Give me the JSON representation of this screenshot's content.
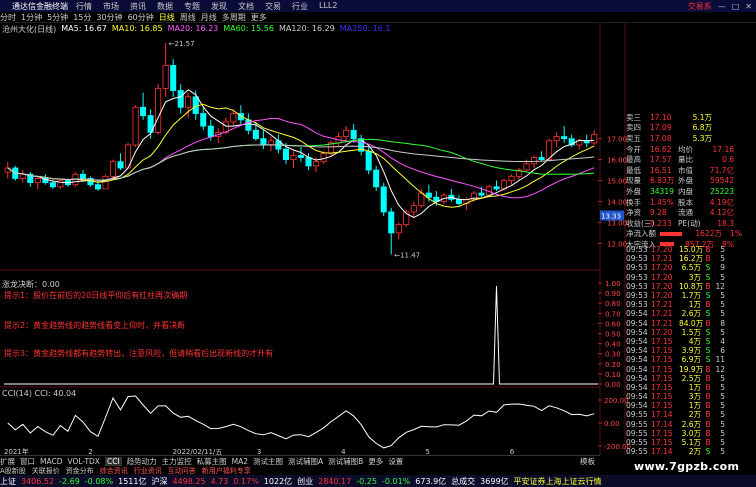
{
  "window": {
    "title": "通达信金融终端",
    "menus": [
      "行情",
      "市场",
      "资讯",
      "数据",
      "专题",
      "发现",
      "文档",
      "交易",
      "行业",
      "LLL2"
    ],
    "account": "交易系"
  },
  "period": {
    "items": [
      "分时",
      "1分钟",
      "5分钟",
      "15分",
      "30分钟",
      "60分钟",
      "日线",
      "周线",
      "月线",
      "多周期",
      "更多"
    ],
    "active": "日线"
  },
  "stock": {
    "name": "沧州大化(日线)"
  },
  "ma": [
    {
      "label": "MA5: 16.67",
      "color": "#ffffff"
    },
    {
      "label": "MA10: 16.85",
      "color": "#ffff33"
    },
    {
      "label": "MA20: 16.23",
      "color": "#ff55ff"
    },
    {
      "label": "MA60: 15.56",
      "color": "#33ff33"
    },
    {
      "label": "MA120: 16.29",
      "color": "#cccccc"
    },
    {
      "label": "MA250: 16.1",
      "color": "#3333ff"
    }
  ],
  "price_axis": [
    "17.00",
    "16.00",
    "15.00",
    "14.00",
    "13.00",
    "12.00"
  ],
  "annot": {
    "high": "21.57",
    "low": "11.47",
    "cur": "13.33"
  },
  "ind1": {
    "header": "涨龙决断：0.00",
    "axis": [
      "1.00",
      "0.90",
      "0.80",
      "0.70",
      "0.60",
      "0.50",
      "0.40",
      "0.30",
      "0.20",
      "0.10",
      "0.00"
    ],
    "tips": [
      "提示1：股价在前后的20日线平仰后有红柱再次确期",
      "提示2：黄金趋势线的趋势线看变上仰时，并看决断",
      "提示3：黄金趋势线都有趋势转出，注意风险，但请稍看后出现新线的才升有"
    ]
  },
  "ind2": {
    "header": "CCI(14) CCI: 40.04",
    "axis": [
      "200.00",
      "0.00",
      "-200.00"
    ]
  },
  "dates": [
    "2021年",
    "2",
    "2022/02/11/五",
    "3",
    "4",
    "5",
    "6"
  ],
  "quote": {
    "top": [
      [
        "卖三",
        "17.10",
        "5.1万"
      ],
      [
        "卖四",
        "17.09",
        "6.8万"
      ],
      [
        "卖五",
        "17.08",
        "5.3万"
      ]
    ],
    "rows": [
      [
        "今开",
        "16.62",
        "均价",
        "17.16"
      ],
      [
        "最高",
        "17.57",
        "量比",
        "0.6"
      ],
      [
        "最低",
        "16.51",
        "市值",
        "71.7亿"
      ],
      [
        "现量",
        "6.83万",
        "外盘",
        "59542"
      ],
      [
        "外盘",
        "34319",
        "内盘",
        "25223"
      ],
      [
        "换手",
        "1.45%",
        "股本",
        "4.19亿"
      ],
      [
        "净资",
        "9.28",
        "流通",
        "4.12亿"
      ],
      [
        "收益(三)",
        "0.233",
        "PE(动)",
        "18.3"
      ]
    ],
    "flow": [
      [
        "净流入额",
        "1622万",
        "1%"
      ],
      [
        "大宗流入",
        "857.2万",
        "8%"
      ]
    ]
  },
  "ticks": [
    [
      "09:53",
      "17.20",
      "15.0万",
      "B",
      "5"
    ],
    [
      "09:53",
      "17.21",
      "16.2万",
      "B",
      "5"
    ],
    [
      "09:53",
      "17.20",
      "6.5万",
      "S",
      "9"
    ],
    [
      "09:53",
      "17.20",
      "3万",
      "S",
      "5"
    ],
    [
      "09:53",
      "17.20",
      "10.8万",
      "B",
      "12"
    ],
    [
      "09:53",
      "17.20",
      "1.7万",
      "S",
      "5"
    ],
    [
      "09:53",
      "17.21",
      "1万",
      "B",
      "5"
    ],
    [
      "09:54",
      "17.21",
      "2.6万",
      "S",
      "5"
    ],
    [
      "09:54",
      "17.21",
      "84.0万",
      "B",
      "8"
    ],
    [
      "09:54",
      "17.20",
      "1.5万",
      "S",
      "5"
    ],
    [
      "09:54",
      "17.15",
      "4万",
      "S",
      "4"
    ],
    [
      "09:54",
      "17.15",
      "3.9万",
      "S",
      "6"
    ],
    [
      "09:54",
      "17.15",
      "6.9万",
      "S",
      "11"
    ],
    [
      "09:54",
      "17.15",
      "19.9万",
      "B",
      "12"
    ],
    [
      "09:54",
      "17.15",
      "2.5万",
      "B",
      "5"
    ],
    [
      "09:54",
      "17.15",
      "1万",
      "B",
      "5"
    ],
    [
      "09:54",
      "17.15",
      "3万",
      "B",
      "5"
    ],
    [
      "09:54",
      "17.15",
      "1万",
      "B",
      "5"
    ],
    [
      "09:55",
      "17.14",
      "2万",
      "B",
      "5"
    ],
    [
      "09:55",
      "17.14",
      "2.6万",
      "B",
      "5"
    ],
    [
      "09:55",
      "17.15",
      "3.0万",
      "B",
      "5"
    ],
    [
      "09:55",
      "17.15",
      "5.1万",
      "B",
      "5"
    ],
    [
      "09:55",
      "17.14",
      "2万",
      "S",
      "5"
    ]
  ],
  "tabs": {
    "items": [
      "扩展",
      "窗口",
      "MACD",
      "VOL-TDX",
      "CCI",
      "趋势动力",
      "主力监控",
      "私募主图",
      "MA2",
      "测试主图",
      "测试辅图A",
      "测试辅图B",
      "更多",
      "设置"
    ],
    "active": "CCI",
    "right": "模板"
  },
  "bottom": {
    "items": [
      "A股新股",
      "关联报价",
      "资金分布",
      "综合资讯",
      "行业资讯",
      "互动问答",
      "新用户福利专享"
    ]
  },
  "status": {
    "items": [
      [
        "上证",
        "#ffffff"
      ],
      [
        "3406.52",
        "#ff3333"
      ],
      [
        "-2.69",
        "#33ff33"
      ],
      [
        "-0.08%",
        "#33ff33"
      ],
      [
        "1511亿",
        "#ffffff"
      ],
      [
        "沪深",
        "#ffffff"
      ],
      [
        "4498.25",
        "#ff3333"
      ],
      [
        "4.73",
        "#ff3333"
      ],
      [
        "0.17%",
        "#ff3333"
      ],
      [
        "1022亿",
        "#ffffff"
      ],
      [
        "创业",
        "#ffffff"
      ],
      [
        "2840.17",
        "#ff3333"
      ],
      [
        "-0.25",
        "#33ff33"
      ],
      [
        "-0.01%",
        "#33ff33"
      ],
      [
        "673.9亿",
        "#ffffff"
      ],
      [
        "总成交",
        "#ffffff"
      ],
      [
        "3699亿",
        "#ffffff"
      ],
      [
        "平安证券上海上证云行情",
        "#ffff33"
      ]
    ]
  },
  "watermark": "www.7gpzb.com",
  "chart_data": {
    "type": "candlestick",
    "price_range": [
      11.3,
      22.0
    ],
    "candles": [
      [
        15.4,
        15.9,
        15.1,
        15.6
      ],
      [
        15.6,
        15.7,
        15.0,
        15.1
      ],
      [
        15.1,
        15.5,
        14.9,
        15.3
      ],
      [
        15.3,
        15.4,
        14.7,
        14.9
      ],
      [
        14.9,
        15.2,
        14.6,
        15.1
      ],
      [
        15.1,
        15.3,
        14.8,
        14.9
      ],
      [
        14.9,
        15.0,
        14.6,
        14.7
      ],
      [
        14.7,
        15.1,
        14.6,
        15.0
      ],
      [
        15.0,
        15.1,
        14.7,
        14.8
      ],
      [
        14.8,
        15.4,
        14.7,
        15.3
      ],
      [
        15.3,
        15.5,
        15.0,
        15.1
      ],
      [
        15.1,
        15.2,
        14.7,
        14.8
      ],
      [
        14.8,
        15.0,
        14.5,
        14.6
      ],
      [
        14.6,
        15.3,
        14.6,
        15.2
      ],
      [
        15.2,
        16.0,
        15.1,
        15.9
      ],
      [
        15.9,
        16.3,
        15.5,
        15.6
      ],
      [
        15.6,
        16.8,
        15.6,
        16.7
      ],
      [
        16.7,
        18.6,
        16.6,
        18.5
      ],
      [
        18.5,
        19.2,
        17.9,
        18.1
      ],
      [
        18.1,
        18.4,
        17.0,
        17.3
      ],
      [
        17.3,
        19.6,
        17.2,
        19.4
      ],
      [
        19.4,
        21.57,
        19.0,
        20.5
      ],
      [
        20.5,
        20.8,
        19.0,
        19.3
      ],
      [
        19.3,
        19.6,
        18.2,
        18.5
      ],
      [
        18.5,
        19.2,
        18.0,
        19.0
      ],
      [
        19.0,
        19.3,
        17.9,
        18.2
      ],
      [
        18.2,
        18.5,
        17.4,
        17.6
      ],
      [
        17.6,
        17.9,
        16.9,
        17.1
      ],
      [
        17.1,
        17.5,
        16.8,
        17.3
      ],
      [
        17.3,
        18.0,
        17.2,
        17.8
      ],
      [
        17.8,
        18.4,
        17.6,
        18.2
      ],
      [
        18.2,
        18.6,
        17.7,
        17.9
      ],
      [
        17.9,
        18.2,
        17.2,
        17.4
      ],
      [
        17.4,
        17.8,
        16.9,
        17.0
      ],
      [
        17.0,
        17.4,
        16.5,
        16.7
      ],
      [
        16.7,
        17.1,
        16.4,
        16.9
      ],
      [
        16.9,
        17.2,
        16.3,
        16.5
      ],
      [
        16.5,
        16.8,
        15.8,
        16.0
      ],
      [
        16.0,
        16.4,
        15.6,
        16.2
      ],
      [
        16.2,
        16.6,
        15.9,
        16.1
      ],
      [
        16.1,
        16.3,
        15.5,
        15.7
      ],
      [
        15.7,
        16.1,
        15.4,
        15.9
      ],
      [
        15.9,
        16.4,
        15.8,
        16.3
      ],
      [
        16.3,
        16.9,
        16.2,
        16.8
      ],
      [
        16.8,
        17.3,
        16.6,
        17.1
      ],
      [
        17.1,
        17.6,
        16.9,
        17.4
      ],
      [
        17.4,
        17.7,
        16.8,
        17.0
      ],
      [
        17.0,
        17.2,
        16.2,
        16.4
      ],
      [
        16.4,
        16.6,
        15.3,
        15.5
      ],
      [
        15.5,
        15.7,
        14.5,
        14.7
      ],
      [
        14.7,
        14.9,
        13.3,
        13.5
      ],
      [
        13.5,
        13.7,
        11.47,
        12.5
      ],
      [
        12.5,
        13.0,
        12.2,
        12.9
      ],
      [
        12.9,
        13.6,
        12.8,
        13.5
      ],
      [
        13.5,
        14.0,
        13.2,
        13.8
      ],
      [
        13.8,
        14.6,
        13.7,
        14.4
      ],
      [
        14.4,
        14.8,
        14.0,
        14.2
      ],
      [
        14.2,
        14.5,
        13.8,
        14.0
      ],
      [
        14.0,
        14.4,
        13.9,
        14.3
      ],
      [
        14.3,
        14.6,
        14.0,
        14.1
      ],
      [
        14.1,
        14.3,
        13.8,
        13.9
      ],
      [
        13.9,
        14.2,
        13.6,
        14.1
      ],
      [
        14.1,
        14.5,
        14.0,
        14.4
      ],
      [
        14.4,
        14.7,
        14.2,
        14.3
      ],
      [
        14.3,
        14.8,
        14.2,
        14.7
      ],
      [
        14.7,
        15.0,
        14.5,
        14.6
      ],
      [
        14.6,
        15.1,
        14.5,
        15.0
      ],
      [
        15.0,
        15.3,
        14.8,
        15.2
      ],
      [
        15.2,
        15.6,
        15.0,
        15.5
      ],
      [
        15.5,
        16.0,
        15.4,
        15.8
      ],
      [
        15.8,
        16.2,
        15.6,
        16.1
      ],
      [
        16.1,
        16.4,
        15.9,
        16.0
      ],
      [
        16.0,
        17.0,
        15.9,
        16.9
      ],
      [
        16.9,
        17.3,
        16.6,
        17.1
      ],
      [
        17.1,
        17.6,
        16.8,
        17.0
      ],
      [
        17.0,
        17.2,
        16.6,
        16.7
      ],
      [
        16.7,
        17.0,
        16.5,
        16.9
      ],
      [
        16.9,
        17.2,
        16.6,
        16.8
      ],
      [
        16.8,
        17.4,
        16.7,
        17.2
      ]
    ]
  }
}
